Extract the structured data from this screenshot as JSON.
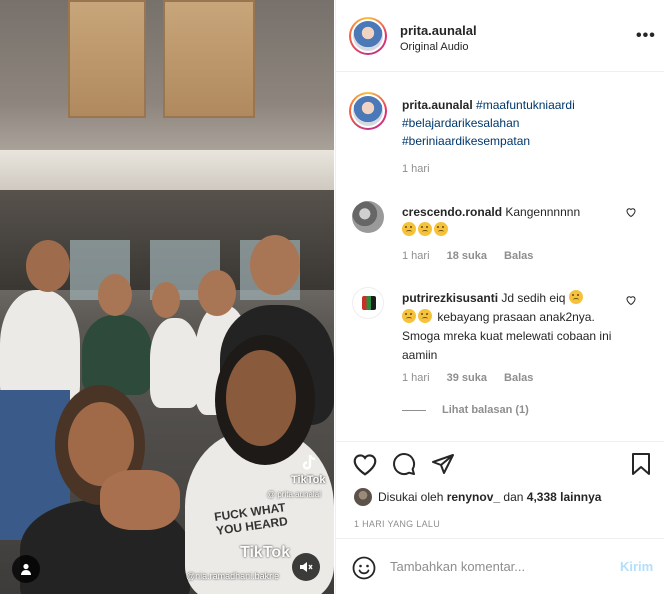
{
  "media": {
    "watermark_brand": "TikTok",
    "watermark_handle": "@ prita.aunalal",
    "watermark_brand_2": "TikTok",
    "watermark_handle_2": "@nia.ramadhani.bakrie",
    "shirt_text_1": "FUCK WHAT",
    "shirt_text_2": "YOU HEARD"
  },
  "header": {
    "username": "prita.aunalal",
    "subtitle": "Original Audio",
    "more_label": "•••"
  },
  "caption": {
    "username": "prita.aunalal",
    "hashtags": [
      "#maafuntukniaardi",
      "#belajardarikesalahan",
      "#beriniaardikesempatan"
    ],
    "time": "1 hari"
  },
  "comments": [
    {
      "username": "crescendo.ronald",
      "text": "Kangennnnnn",
      "emoji_count": 3,
      "time": "1 hari",
      "likes": "18 suka",
      "reply": "Balas"
    },
    {
      "username": "putrirezkisusanti",
      "text_1": "Jd sedih eiq",
      "text_2": "kebayang prasaan anak2nya. Smoga mreka kuat melewati cobaan ini aamiin",
      "time": "1 hari",
      "likes": "39 suka",
      "reply": "Balas",
      "view_replies": "Lihat balasan (1)"
    }
  ],
  "actions": {
    "liked_by_prefix": "Disukai oleh ",
    "liked_by_user": "renynov_",
    "liked_by_mid": " dan ",
    "liked_by_count": "4,338 lainnya",
    "date": "1 HARI YANG LALU"
  },
  "add_comment": {
    "placeholder": "Tambahkan komentar...",
    "post_label": "Kirim"
  },
  "colors": {
    "link": "#00376b",
    "muted": "#8e8e8e",
    "post_disabled": "#b2dffc"
  }
}
